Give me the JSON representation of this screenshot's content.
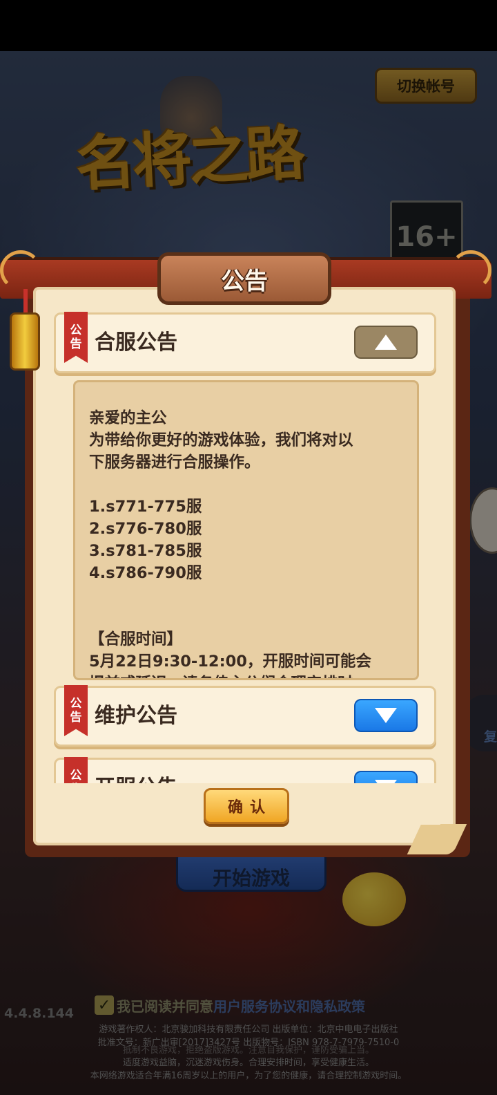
{
  "background": {
    "switch_account": "切换帐号",
    "logo_text": "名将之路",
    "age_rating": "16+",
    "start_game": "开始游戏",
    "side_partial": "复",
    "version": "4.4.8.144",
    "agree_text": "我已阅读并同意",
    "user_agreement": "用户服务协议",
    "and_text": "和",
    "privacy_policy": "隐私政策",
    "legal_lines": [
      "游戏著作权人：北京骏加科技有限责任公司  出版单位：北京中电电子出版社",
      "批准文号：新广出审[2017]3427号  出版物号：ISBN 978-7-7979-7510-0",
      "抵制不良游戏，拒绝盗版游戏。注意自我保护，谨防受骗上当。",
      "适度游戏益脑，沉迷游戏伤身。合理安排时间，享受健康生活。",
      "本网络游戏适合年满16周岁以上的用户，为了您的健康，请合理控制游戏时间。"
    ]
  },
  "dialog": {
    "title": "公告",
    "tag_label_top": "公",
    "tag_label_bottom": "告",
    "sections": [
      {
        "title": "合服公告",
        "expanded": true
      },
      {
        "title": "维护公告",
        "expanded": false
      },
      {
        "title": "开服公告",
        "expanded": false
      }
    ],
    "content_lines": {
      "greeting": "亲爱的主公",
      "intro_1": "为带给你更好的游戏体验，我们将对以",
      "intro_2": "下服务器进行合服操作。",
      "servers": [
        "1.s771-775服",
        "2.s776-780服",
        "3.s781-785服",
        "4.s786-790服"
      ],
      "time_heading": "【合服时间】",
      "time_1": "5月22日9:30-12:00，开服时间可能会",
      "time_2": "提前或延迟，请务佳主公们合理安排时"
    },
    "confirm_label": "确认"
  },
  "colors": {
    "paper": "#f6e7c8",
    "accent_blue": "#1a78e6",
    "tag_red": "#c6302a",
    "gold": "#f0a624"
  }
}
